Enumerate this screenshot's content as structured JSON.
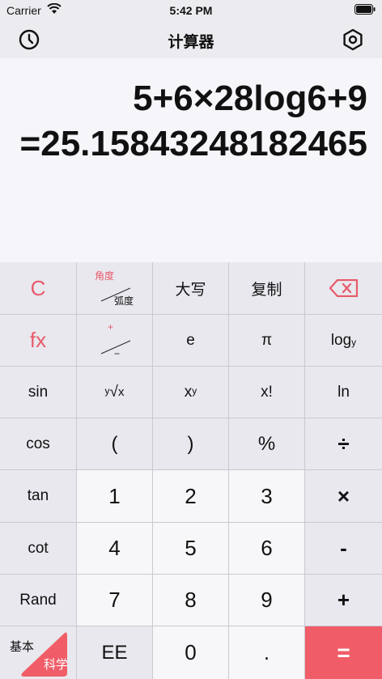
{
  "status": {
    "carrier": "Carrier",
    "time": "5:42 PM"
  },
  "nav": {
    "title": "计算器",
    "history_icon": "clock-icon",
    "settings_icon": "hexagon-gear-icon"
  },
  "display": {
    "expression": "5+6×28log6+9",
    "result": "=25.15843248182465"
  },
  "keys": {
    "clear": "C",
    "angle_top": "角度",
    "angle_bottom": "弧度",
    "upper": "大写",
    "copy": "复制",
    "fx": "fx",
    "plus_minus_top": "+",
    "plus_minus_bottom": "−",
    "e": "e",
    "pi": "π",
    "log_base": "log",
    "log_sub": "y",
    "sin": "sin",
    "root_y": "y",
    "root_x": "x",
    "pow_base": "x",
    "pow_exp": "y",
    "fact": "x!",
    "ln": "ln",
    "cos": "cos",
    "lparen": "(",
    "rparen": ")",
    "percent": "%",
    "divide": "÷",
    "tan": "tan",
    "n1": "1",
    "n2": "2",
    "n3": "3",
    "multiply": "×",
    "cot": "cot",
    "n4": "4",
    "n5": "5",
    "n6": "6",
    "minus": "-",
    "rand": "Rand",
    "n7": "7",
    "n8": "8",
    "n9": "9",
    "plus": "+",
    "mode_basic": "基本",
    "mode_science": "科学",
    "ee": "EE",
    "n0": "0",
    "dot": ".",
    "equals": "="
  },
  "colors": {
    "accent": "#f05d68",
    "accent_text": "#e85a6a"
  }
}
